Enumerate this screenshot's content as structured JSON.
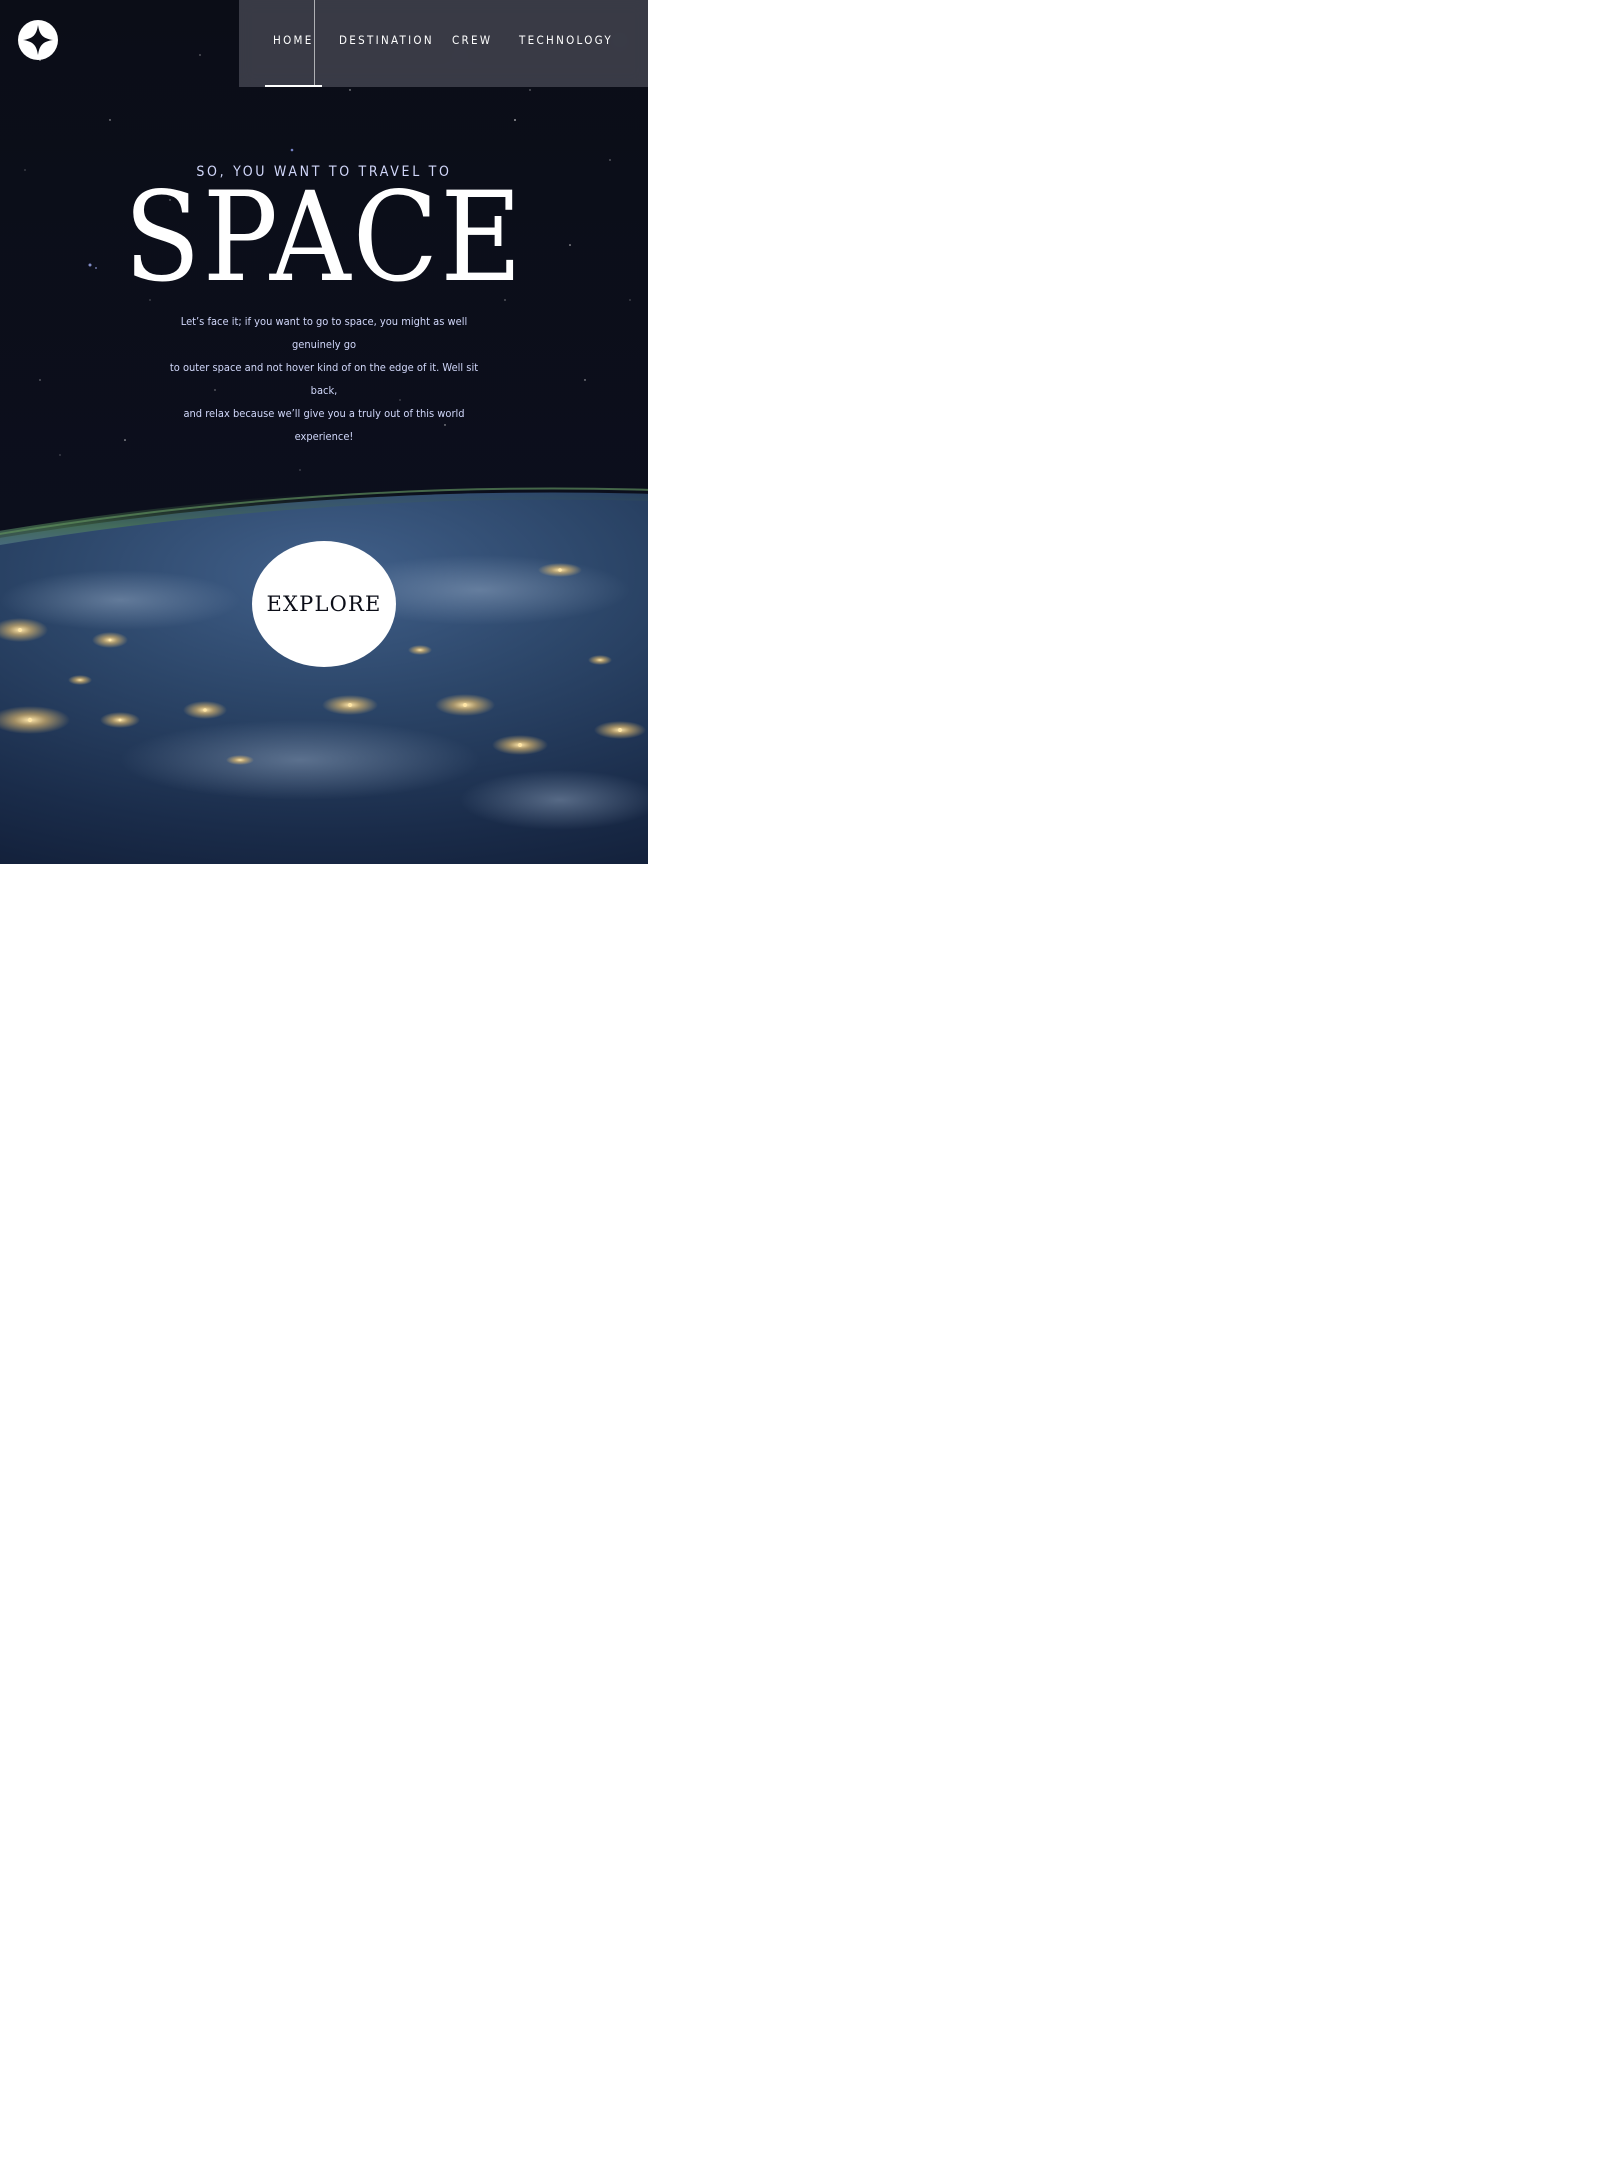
{
  "brand": {
    "logo_icon": "star-logo-icon"
  },
  "nav": {
    "items": [
      {
        "label": "HOME",
        "active": true
      },
      {
        "label": "DESTINATION",
        "active": false
      },
      {
        "label": "CREW",
        "active": false
      },
      {
        "label": "TECHNOLOGY",
        "active": false
      }
    ]
  },
  "hero": {
    "subtitle": "SO, YOU WANT TO TRAVEL TO",
    "title": "SPACE",
    "text_lines": [
      "Let’s face it; if you want to go to space, you might as well genuinely go",
      "to outer space and not hover kind of on the edge of it. Well sit back,",
      "and relax because we’ll give you a truly out of this world experience!"
    ],
    "explore_label": "EXPLORE"
  },
  "colors": {
    "background": "#0b0d17",
    "accent_text": "#d0d6f9",
    "white": "#ffffff"
  }
}
